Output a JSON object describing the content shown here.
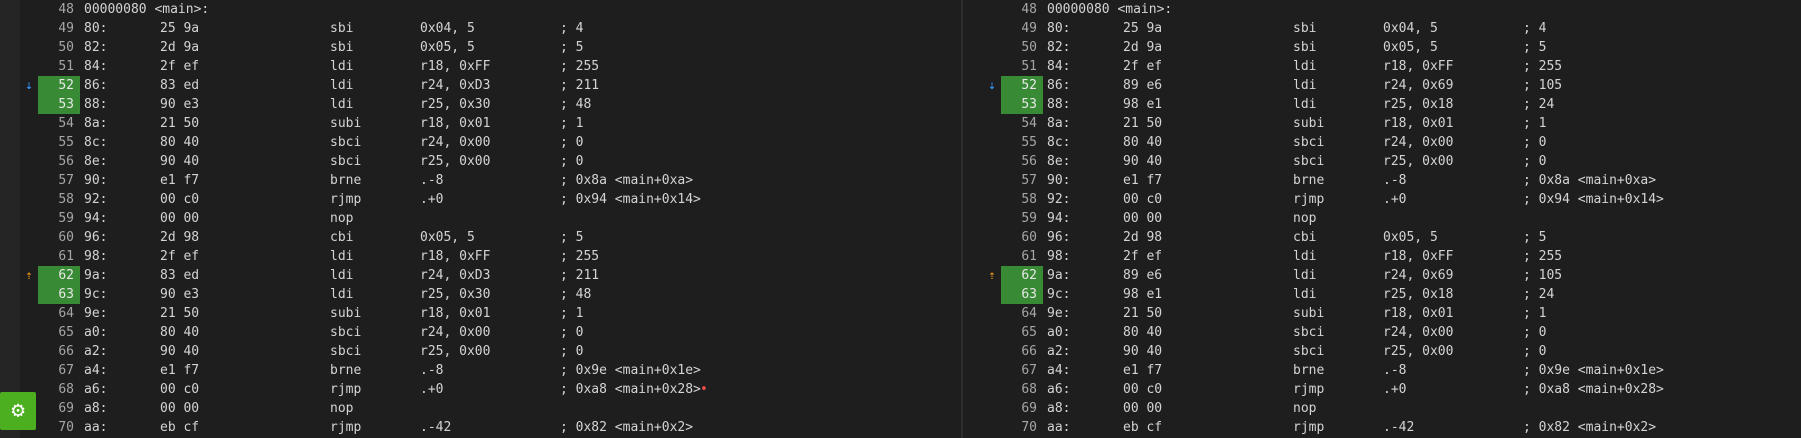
{
  "left_pane": {
    "lines": [
      {
        "n": "48",
        "code": "00000080 <main>:"
      },
      {
        "n": "49",
        "code": "  80:\t25 9a       \tsbi\t0x04, 5\t; 4"
      },
      {
        "n": "50",
        "code": "  82:\t2d 9a       \tsbi\t0x05, 5\t; 5"
      },
      {
        "n": "51",
        "code": "  84:\t2f ef       \tldi\tr18, 0xFF\t; 255"
      },
      {
        "n": "52",
        "code": "  86:\t83 ed       \tldi\tr24, 0xD3\t; 211",
        "hl": true,
        "arrow": "down"
      },
      {
        "n": "53",
        "code": "  88:\t90 e3       \tldi\tr25, 0x30\t; 48",
        "hl": true
      },
      {
        "n": "54",
        "code": "  8a:\t21 50       \tsubi\tr18, 0x01\t; 1"
      },
      {
        "n": "55",
        "code": "  8c:\t80 40       \tsbci\tr24, 0x00\t; 0"
      },
      {
        "n": "56",
        "code": "  8e:\t90 40       \tsbci\tr25, 0x00\t; 0"
      },
      {
        "n": "57",
        "code": "  90:\te1 f7       \tbrne\t.-8      \t; 0x8a <main+0xa>"
      },
      {
        "n": "58",
        "code": "  92:\t00 c0       \trjmp\t.+0      \t; 0x94 <main+0x14>"
      },
      {
        "n": "59",
        "code": "  94:\t00 00       \tnop"
      },
      {
        "n": "60",
        "code": "  96:\t2d 98       \tcbi\t0x05, 5\t; 5"
      },
      {
        "n": "61",
        "code": "  98:\t2f ef       \tldi\tr18, 0xFF\t; 255"
      },
      {
        "n": "62",
        "code": "  9a:\t83 ed       \tldi\tr24, 0xD3\t; 211",
        "hl": true,
        "arrow": "up"
      },
      {
        "n": "63",
        "code": "  9c:\t90 e3       \tldi\tr25, 0x30\t; 48",
        "hl": true
      },
      {
        "n": "64",
        "code": "  9e:\t21 50       \tsubi\tr18, 0x01\t; 1"
      },
      {
        "n": "65",
        "code": "  a0:\t80 40       \tsbci\tr24, 0x00\t; 0"
      },
      {
        "n": "66",
        "code": "  a2:\t90 40       \tsbci\tr25, 0x00\t; 0"
      },
      {
        "n": "67",
        "code": "  a4:\te1 f7       \tbrne\t.-8      \t; 0x9e <main+0x1e>"
      },
      {
        "n": "68",
        "code": "  a6:\t00 c0       \trjmp\t.+0      \t; 0xa8 <main+0x28>",
        "marker": true
      },
      {
        "n": "69",
        "code": "  a8:\t00 00       \tnop"
      },
      {
        "n": "70",
        "code": "  aa:\teb cf       \trjmp\t.-42     \t; 0x82 <main+0x2>"
      }
    ]
  },
  "right_pane": {
    "lines": [
      {
        "n": "48",
        "code": "00000080 <main>:"
      },
      {
        "n": "49",
        "code": "  80:\t25 9a       \tsbi\t0x04, 5\t; 4"
      },
      {
        "n": "50",
        "code": "  82:\t2d 9a       \tsbi\t0x05, 5\t; 5"
      },
      {
        "n": "51",
        "code": "  84:\t2f ef       \tldi\tr18, 0xFF\t; 255"
      },
      {
        "n": "52",
        "code": "  86:\t89 e6       \tldi\tr24, 0x69\t; 105",
        "hl": true,
        "arrow": "down"
      },
      {
        "n": "53",
        "code": "  88:\t98 e1       \tldi\tr25, 0x18\t; 24",
        "hl": true
      },
      {
        "n": "54",
        "code": "  8a:\t21 50       \tsubi\tr18, 0x01\t; 1"
      },
      {
        "n": "55",
        "code": "  8c:\t80 40       \tsbci\tr24, 0x00\t; 0"
      },
      {
        "n": "56",
        "code": "  8e:\t90 40       \tsbci\tr25, 0x00\t; 0"
      },
      {
        "n": "57",
        "code": "  90:\te1 f7       \tbrne\t.-8      \t; 0x8a <main+0xa>"
      },
      {
        "n": "58",
        "code": "  92:\t00 c0       \trjmp\t.+0      \t; 0x94 <main+0x14>"
      },
      {
        "n": "59",
        "code": "  94:\t00 00       \tnop"
      },
      {
        "n": "60",
        "code": "  96:\t2d 98       \tcbi\t0x05, 5\t; 5"
      },
      {
        "n": "61",
        "code": "  98:\t2f ef       \tldi\tr18, 0xFF\t; 255"
      },
      {
        "n": "62",
        "code": "  9a:\t89 e6       \tldi\tr24, 0x69\t; 105",
        "hl": true,
        "arrow": "up"
      },
      {
        "n": "63",
        "code": "  9c:\t98 e1       \tldi\tr25, 0x18\t; 24",
        "hl": true
      },
      {
        "n": "64",
        "code": "  9e:\t21 50       \tsubi\tr18, 0x01\t; 1"
      },
      {
        "n": "65",
        "code": "  a0:\t80 40       \tsbci\tr24, 0x00\t; 0"
      },
      {
        "n": "66",
        "code": "  a2:\t90 40       \tsbci\tr25, 0x00\t; 0"
      },
      {
        "n": "67",
        "code": "  a4:\te1 f7       \tbrne\t.-8      \t; 0x9e <main+0x1e>"
      },
      {
        "n": "68",
        "code": "  a6:\t00 c0       \trjmp\t.+0      \t; 0xa8 <main+0x28>"
      },
      {
        "n": "69",
        "code": "  a8:\t00 00       \tnop"
      },
      {
        "n": "70",
        "code": "  aa:\teb cf       \trjmp\t.-42     \t; 0x82 <main+0x2>"
      }
    ]
  },
  "icons": {
    "settings": "gear-icon",
    "down_arrow": "arrow-down-icon",
    "up_arrow": "arrow-up-icon",
    "settings_glyph": "⚙",
    "down_glyph": "⇣",
    "up_glyph": "⇡",
    "marker_glyph": "•"
  },
  "colors": {
    "background": "#1e1e1e",
    "line_highlight": "#388a34",
    "changed_text_bg": "#264f78",
    "down_arrow": "#3794ff",
    "up_arrow": "#d18616",
    "settings_button": "#4caf1f"
  }
}
